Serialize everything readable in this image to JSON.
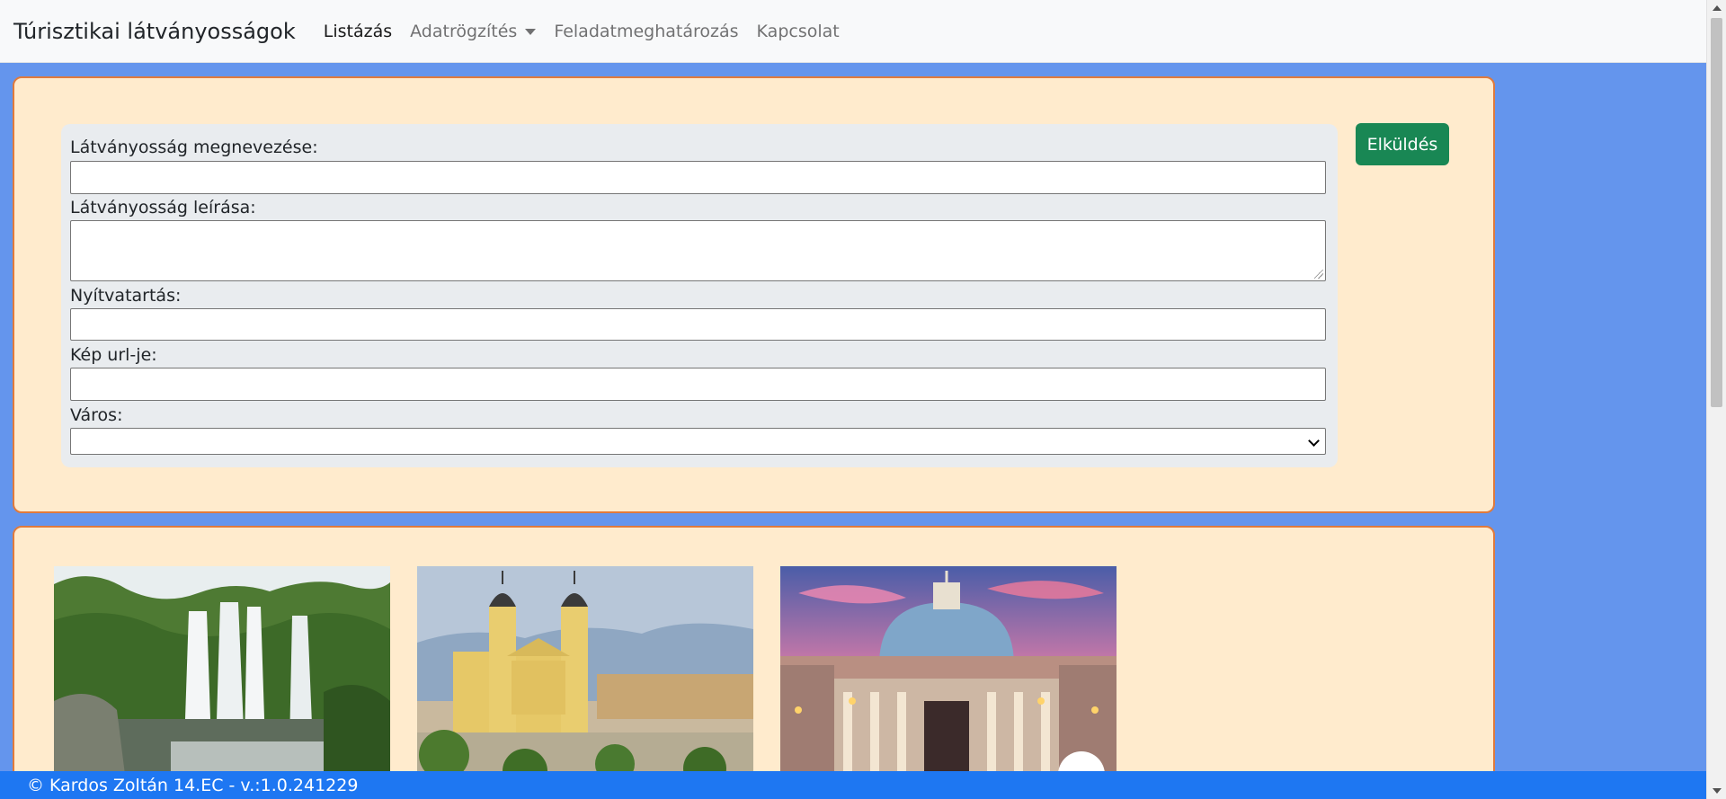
{
  "navbar": {
    "brand": "Túrisztikai látványosságok",
    "items": [
      {
        "label": "Listázás"
      },
      {
        "label": "Adatrögzítés"
      },
      {
        "label": "Feladatmeghatározás"
      },
      {
        "label": "Kapcsolat"
      }
    ]
  },
  "form": {
    "name_label": "Látványosság megnevezése:",
    "name_value": "",
    "description_label": "Látványosság leírása:",
    "description_value": "",
    "opening_label": "Nyítvatartás:",
    "opening_value": "",
    "image_url_label": "Kép url-je:",
    "image_url_value": "",
    "city_label": "Város:",
    "city_selected": "",
    "submit_label": "Elküldés"
  },
  "gallery": {
    "images": [
      {
        "subject": "waterfall"
      },
      {
        "subject": "yellow-church-with-twin-towers"
      },
      {
        "subject": "domed-basilica-at-dusk"
      }
    ]
  },
  "footer": {
    "text": "© Kardos Zoltán 14.EC - v.:1.0.241229"
  },
  "colors": {
    "page_background": "#6495ED",
    "panel_background": "#FFEBCD",
    "panel_border": "#E07A3C",
    "submit_button": "#198754",
    "footer_background": "#1E77F2"
  }
}
